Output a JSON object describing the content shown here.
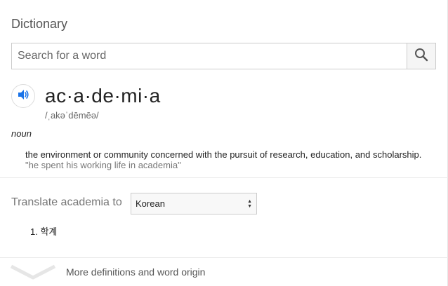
{
  "title": "Dictionary",
  "search": {
    "placeholder": "Search for a word",
    "value": ""
  },
  "entry": {
    "word": "ac·a·de·mi·a",
    "phonetic": "/ˌakəˈdēmēə/",
    "part_of_speech": "noun",
    "definition": "the environment or community concerned with the pursuit of research, education, and scholarship.",
    "example": "\"he spent his working life in academia\""
  },
  "translate": {
    "label": "Translate academia to",
    "selected_language": "Korean",
    "results": [
      "1. 학계"
    ]
  },
  "more": {
    "label": "More definitions and word origin"
  },
  "colors": {
    "accent": "#1a73e8",
    "muted": "#777777"
  }
}
